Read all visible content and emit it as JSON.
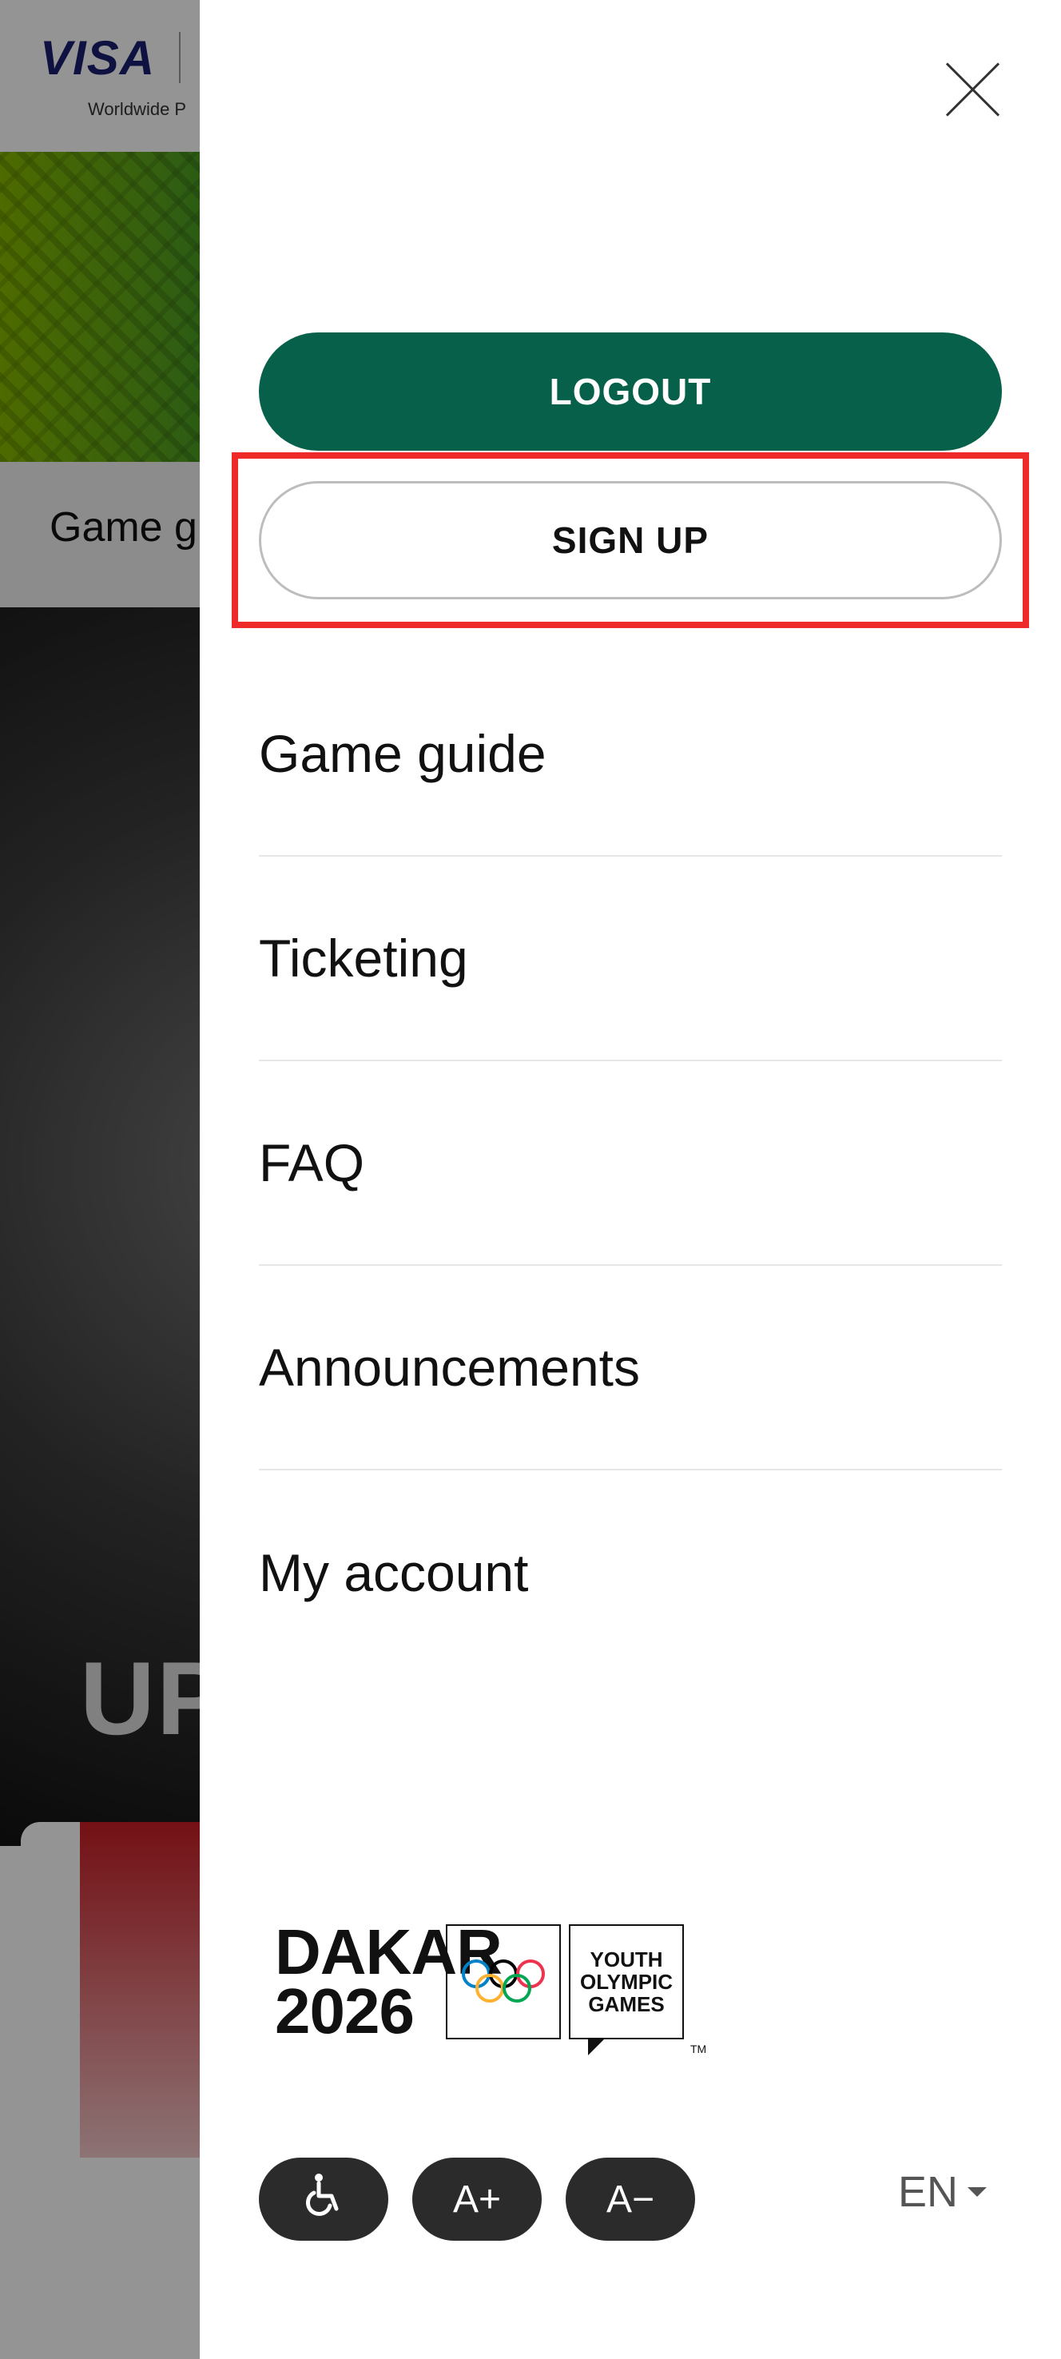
{
  "background": {
    "brand": "VISA",
    "brand_sub": "Worldwide P",
    "tab_label": "Game g",
    "hero_text": "UPC"
  },
  "drawer": {
    "logout_label": "LOGOUT",
    "signup_label": "SIGN UP",
    "menu": [
      {
        "label": "Game guide"
      },
      {
        "label": "Ticketing"
      },
      {
        "label": "FAQ"
      },
      {
        "label": "Announcements"
      },
      {
        "label": "My account"
      }
    ],
    "logo": {
      "line1": "DAKAR",
      "line2": "2026",
      "yog": [
        "YOUTH",
        "OLYMPIC",
        "GAMES"
      ],
      "tm": "TM"
    },
    "accessibility": {
      "icon": "wheelchair-icon",
      "increase_label": "A+",
      "decrease_label": "A−"
    },
    "language": "EN"
  },
  "colors": {
    "primary": "#06604a",
    "highlight": "#ee2a2a",
    "pill": "#2b2b2b"
  }
}
